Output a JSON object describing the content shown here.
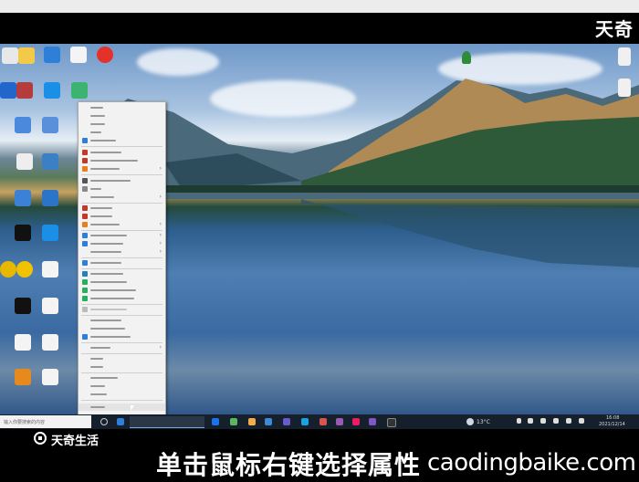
{
  "watermark": {
    "brand_top": "天奇",
    "brand_bottom": "天奇生活",
    "site": "caodingbaike.com"
  },
  "caption": "单击鼠标右键选择属性",
  "search": {
    "placeholder": "输入你要搜索的内容"
  },
  "tray": {
    "temperature": "13°C",
    "time": "16:08",
    "date": "2021/12/14"
  },
  "colors": {
    "taskbar": "#16202c",
    "menu_bg": "#f2f2f2",
    "caption": "#ffffff"
  }
}
